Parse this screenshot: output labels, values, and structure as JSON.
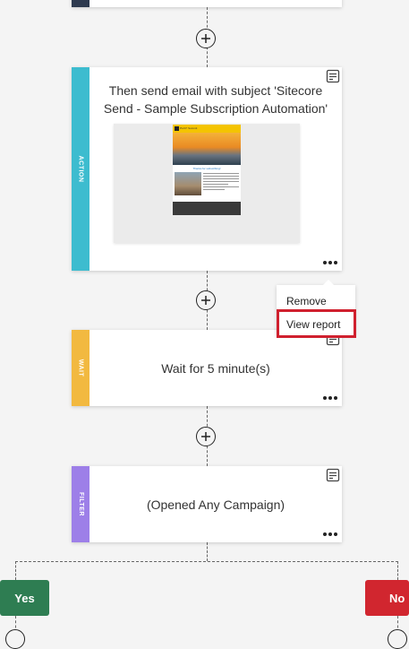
{
  "flow": {
    "action_card": {
      "stripe_label": "ACTION",
      "title_line1": "Then send email with subject 'Sitecore",
      "title_line2": "Send - Sample Subscription Automation'",
      "preview": {
        "brand": "PLAY! Summit",
        "heading": "Thanks for subscribing!"
      }
    },
    "wait_card": {
      "stripe_label": "WAIT",
      "text": "Wait for 5 minute(s)"
    },
    "filter_card": {
      "stripe_label": "FILTER",
      "text": "(Opened Any Campaign)"
    },
    "branches": {
      "yes_label": "Yes",
      "no_label": "No"
    }
  },
  "context_menu": {
    "items": [
      "Remove",
      "View report"
    ]
  },
  "colors": {
    "action": "#3dbccf",
    "wait": "#f2b940",
    "filter": "#9d7fe8",
    "yes": "#2e7d52",
    "no": "#d1262f",
    "highlight": "#d0202e",
    "background": "#f4f4f4"
  }
}
